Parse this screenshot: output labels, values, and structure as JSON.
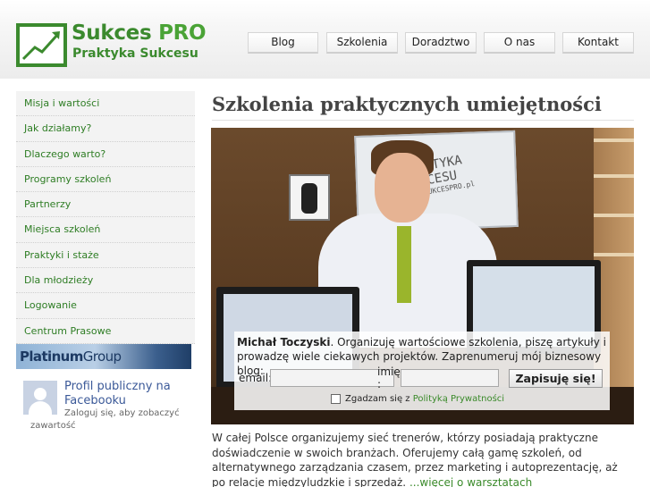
{
  "brand": {
    "name_part1": "Sukces",
    "name_part2": "PRO",
    "tagline": "Praktyka Sukcesu",
    "colors": {
      "primary_green": "#3b8a2e",
      "link_green": "#3a8a2a",
      "facebook_blue": "#3b5998"
    }
  },
  "nav": {
    "items": [
      {
        "label": "Blog"
      },
      {
        "label": "Szkolenia"
      },
      {
        "label": "Doradztwo"
      },
      {
        "label": "O nas"
      },
      {
        "label": "Kontakt"
      }
    ]
  },
  "sidebar": {
    "items": [
      {
        "label": "Misja i wartości"
      },
      {
        "label": "Jak działamy?"
      },
      {
        "label": "Dlaczego warto?"
      },
      {
        "label": "Programy szkoleń"
      },
      {
        "label": "Partnerzy"
      },
      {
        "label": "Miejsca szkoleń"
      },
      {
        "label": "Praktyki i staże"
      },
      {
        "label": "Dla młodzieży"
      },
      {
        "label": "Logowanie"
      },
      {
        "label": "Centrum Prasowe"
      }
    ],
    "banner": {
      "part1": "Platinum",
      "part2": "Group"
    }
  },
  "facebook": {
    "title": "Profil publiczny na Facebooku",
    "subtitle": "Zaloguj się, aby zobaczyć zawartość"
  },
  "main": {
    "heading": "Szkolenia praktycznych umiejętności",
    "whiteboard_text": [
      "PRAKTYKA",
      "SUKCESU",
      "www.SUKCESPRO.pl"
    ],
    "signup": {
      "author": "Michał Toczyski",
      "intro": ". Organizuję wartościowe szkolenia, piszę artykuły i prowadzę wiele ciekawych projektów. Zaprenumeruj mój biznesowy blog:",
      "email_label": "email:",
      "name_label": "imię :",
      "submit_label": "Zapisuję się!",
      "consent_text": "Zgadzam się z ",
      "consent_link": "Polityką Prywatności"
    },
    "body_text": "W całej Polsce organizujemy sieć trenerów, którzy posiadają praktyczne doświadczenie w swoich branżach. Oferujemy całą gamę szkoleń, od alternatywnego zarządzania czasem, przez marketing i autoprezentację, aż po relacje międzyludzkie i sprzedaż. ",
    "more_link": "...więcej o warsztatach"
  }
}
